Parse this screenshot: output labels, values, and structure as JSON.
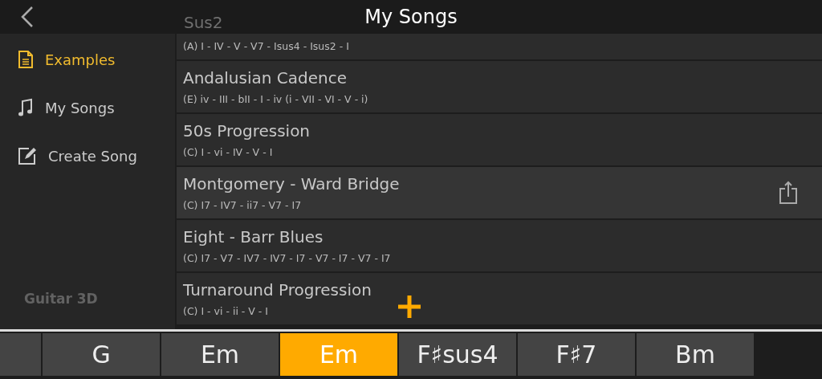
{
  "header": {
    "title": "My Songs"
  },
  "sidebar": {
    "items": [
      {
        "label": "Examples",
        "kind": "document",
        "selected": true
      },
      {
        "label": "My Songs",
        "kind": "note",
        "selected": false
      },
      {
        "label": "Create Song",
        "kind": "edit",
        "selected": false
      }
    ],
    "footer": "Guitar 3D"
  },
  "songs": [
    {
      "title": "Sus2",
      "progression": "(A) I - IV - V - V7 - Isus4 - Isus2 - I",
      "selected": false
    },
    {
      "title": "Andalusian Cadence",
      "progression": "(E)  iv - III - bII - I - iv (i - VII - VI - V - i)",
      "selected": false
    },
    {
      "title": "50s Progression",
      "progression": "(C)  I - vi - IV - V - I",
      "selected": false
    },
    {
      "title": "Montgomery - Ward Bridge",
      "progression": "(C)  I7 - IV7 - ii7 - V7 - I7",
      "selected": true
    },
    {
      "title": "Eight - Barr Blues",
      "progression": "(C)  I7 - V7 - IV7 - IV7 - I7 - V7 - I7 - V7 - I7",
      "selected": false
    },
    {
      "title": "Turnaround Progression",
      "progression": "(C)  I - vi - ii - V - I",
      "selected": false
    }
  ],
  "chords": [
    {
      "label": "G",
      "selected": false
    },
    {
      "label": "Em",
      "selected": false
    },
    {
      "label": "Em",
      "selected": true
    },
    {
      "label": "F♯sus4",
      "selected": false
    },
    {
      "label": "F♯7",
      "selected": false
    },
    {
      "label": "Bm",
      "selected": false
    }
  ]
}
